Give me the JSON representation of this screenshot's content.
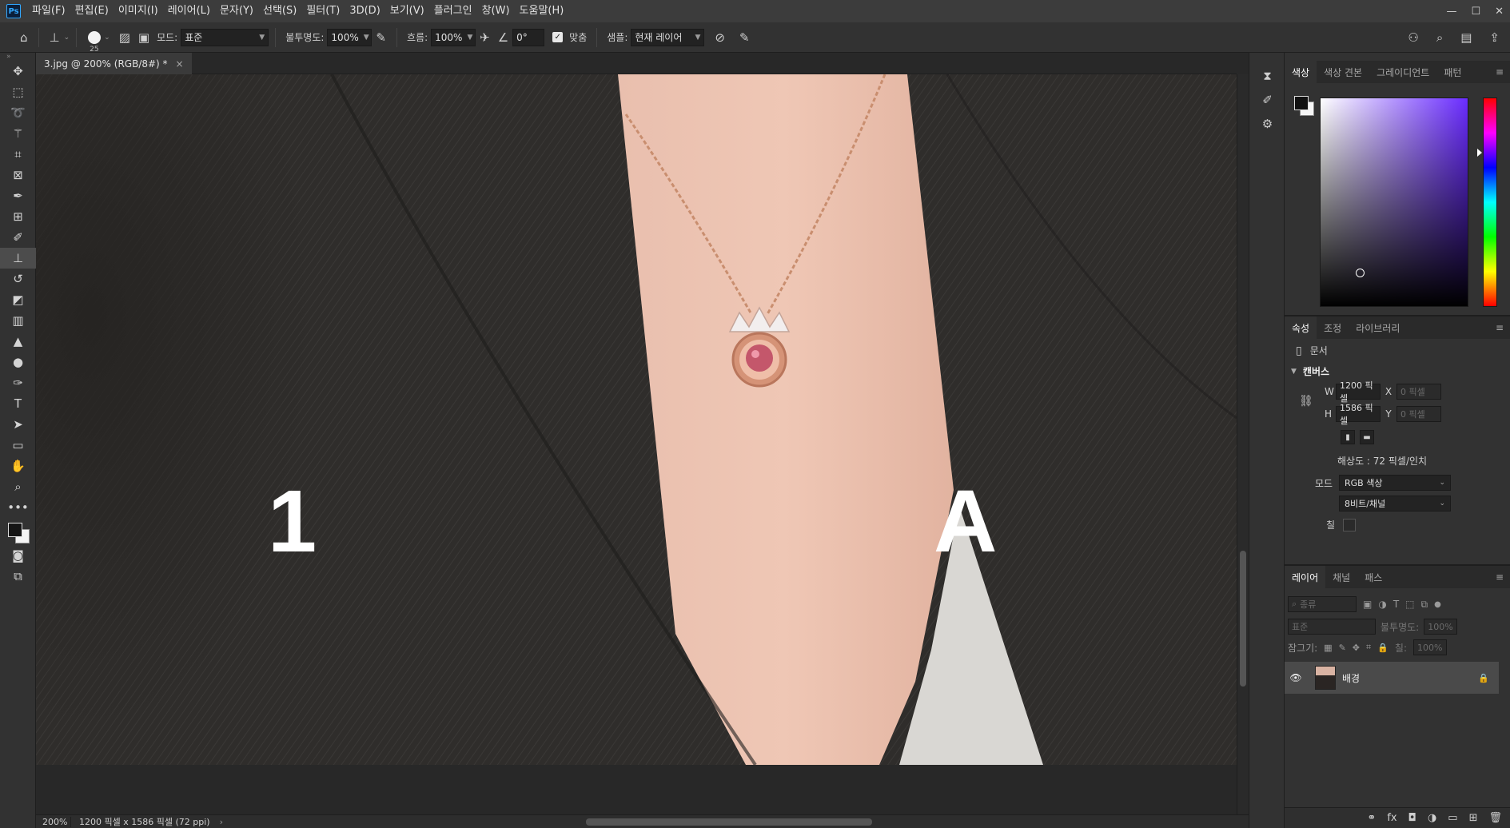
{
  "app": {
    "logo": "Ps"
  },
  "menu": [
    "파일(F)",
    "편집(E)",
    "이미지(I)",
    "레이어(L)",
    "문자(Y)",
    "선택(S)",
    "필터(T)",
    "3D(D)",
    "보기(V)",
    "플러그인",
    "창(W)",
    "도움말(H)"
  ],
  "window_controls": [
    "—",
    "☐",
    "✕"
  ],
  "options": {
    "brush_size": "25",
    "mode_label": "모드:",
    "mode_value": "표준",
    "opacity_label": "불투명도:",
    "opacity_value": "100%",
    "flow_label": "흐름:",
    "flow_value": "100%",
    "angle_value": "0°",
    "aligned_label": "맞춤",
    "sample_label": "샘플:",
    "sample_value": "현재 레이어"
  },
  "document": {
    "tab_title": "3.jpg @ 200% (RGB/8#) *",
    "overlay_left": "1",
    "overlay_right": "A"
  },
  "status": {
    "zoom": "200%",
    "info": "1200 픽셀 x 1586 픽셀 (72 ppi)"
  },
  "color_panel": {
    "tabs": [
      "색상",
      "색상 견본",
      "그레이디언트",
      "패턴"
    ]
  },
  "properties_panel": {
    "tabs": [
      "속성",
      "조정",
      "라이브러리"
    ],
    "doc_label": "문서",
    "section": "캔버스",
    "w_label": "W",
    "w_value": "1200 픽셀",
    "h_label": "H",
    "h_value": "1586 픽셀",
    "x_label": "X",
    "x_placeholder": "0 픽셀",
    "y_label": "Y",
    "y_placeholder": "0 픽셀",
    "resolution": "해상도 : 72 픽셀/인치",
    "mode_label": "모드",
    "mode_value": "RGB 색상",
    "depth_value": "8비트/채널",
    "fill_label": "칠"
  },
  "layers_panel": {
    "tabs": [
      "레이어",
      "채널",
      "패스"
    ],
    "filter_placeholder": "종류",
    "blend_value": "표준",
    "opacity_label": "불투명도:",
    "opacity_value": "100%",
    "lock_label": "잠그기:",
    "fill_label": "칠:",
    "fill_value": "100%",
    "layer_name": "배경"
  }
}
